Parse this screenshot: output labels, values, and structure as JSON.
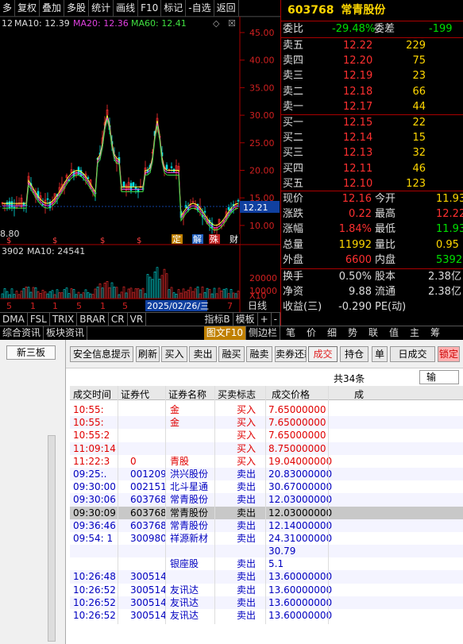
{
  "menu": [
    "多",
    "复权",
    "叠加",
    "多股",
    "统计",
    "画线",
    "F10",
    "标记",
    "-自选",
    "返回"
  ],
  "ma_line": {
    "prefix": "12",
    "ma10": "MA10: 12.39",
    "ma20": "MA20: 12.36",
    "ma60": "MA60: 12.41"
  },
  "price_axis": [
    "45.00",
    "40.00",
    "35.00",
    "30.00",
    "25.00",
    "20.00",
    "15.00",
    "10.00"
  ],
  "current_price_tag": "12.21",
  "low_label": "8.80",
  "vol_line": {
    "prefix": "3902",
    "ma10": "MA10: 24541"
  },
  "vol_axis": [
    "20000",
    "10000",
    "X10"
  ],
  "date_tag": "2025/02/26/三",
  "period_label": "日线",
  "event_marks": [
    "定",
    "解",
    "殊",
    "财"
  ],
  "indicator_tabs": [
    "DMA",
    "FSL",
    "TRIX",
    "BRAR",
    "CR",
    "VR"
  ],
  "tool_tabs": [
    "指标B",
    "模板",
    "+",
    "-"
  ],
  "sub_tabs": [
    "综合资讯",
    "板块资讯"
  ],
  "chart_link": "图文F10",
  "side_link": "侧边栏",
  "stock": {
    "code": "603768",
    "name": "常青股份"
  },
  "weibi": {
    "label": "委比",
    "value": "-29.48%",
    "label2": "委差",
    "value2": "-199"
  },
  "sells": [
    {
      "label": "卖五",
      "price": "12.22",
      "vol": "229"
    },
    {
      "label": "卖四",
      "price": "12.20",
      "vol": "75"
    },
    {
      "label": "卖三",
      "price": "12.19",
      "vol": "23"
    },
    {
      "label": "卖二",
      "price": "12.18",
      "vol": "66"
    },
    {
      "label": "卖一",
      "price": "12.17",
      "vol": "44"
    }
  ],
  "buys": [
    {
      "label": "买一",
      "price": "12.15",
      "vol": "22"
    },
    {
      "label": "买二",
      "price": "12.14",
      "vol": "15"
    },
    {
      "label": "买三",
      "price": "12.13",
      "vol": "32"
    },
    {
      "label": "买四",
      "price": "12.11",
      "vol": "46"
    },
    {
      "label": "买五",
      "price": "12.10",
      "vol": "123"
    }
  ],
  "stats": [
    {
      "l1": "现价",
      "v1": "12.16",
      "l2": "今开",
      "v2": "11.93"
    },
    {
      "l1": "涨跌",
      "v1": "0.22",
      "l2": "最高",
      "v2": "12.22"
    },
    {
      "l1": "涨幅",
      "v1": "1.84%",
      "l2": "最低",
      "v2": "11.93"
    },
    {
      "l1": "总量",
      "v1": "11992",
      "l2": "量比",
      "v2": "0.95"
    },
    {
      "l1": "外盘",
      "v1": "6600",
      "l2": "内盘",
      "v2": "5392"
    }
  ],
  "stats2": [
    {
      "l1": "换手",
      "v1": "0.50%",
      "l2": "股本",
      "v2": "2.38亿"
    },
    {
      "l1": "净资",
      "v1": "9.88",
      "l2": "流通",
      "v2": "2.38亿"
    },
    {
      "l1": "收益(三)",
      "v1": "-0.290",
      "l2": "PE(动)",
      "v2": ""
    }
  ],
  "right_tabs": [
    "笔",
    "价",
    "细",
    "势",
    "联",
    "值",
    "主",
    "筹"
  ],
  "left_panel": {
    "tab": "新三板"
  },
  "toolbar": {
    "buttons": [
      "安全信息提示",
      "刷新",
      "买入",
      "卖出",
      "融买",
      "融卖",
      "卖券还款",
      "成交",
      "持仓",
      "单",
      "日成交",
      "锁定"
    ]
  },
  "table_meta": {
    "count": "共34条",
    "search": "输"
  },
  "columns": [
    "成交时间",
    "证券代",
    "证券名称",
    "买卖标志",
    "成交价格",
    "成"
  ],
  "rows": [
    {
      "time": "10:55:",
      "code": "",
      "name": "金",
      "side": "买入",
      "price": "7.65000000",
      "color": "red"
    },
    {
      "time": "10:55:",
      "code": "",
      "name": "金",
      "side": "买入",
      "price": "7.65000000",
      "color": "red"
    },
    {
      "time": "10:55:2",
      "code": "",
      "name": "",
      "side": "买入",
      "price": "7.65000000",
      "color": "red"
    },
    {
      "time": "11:09:14",
      "code": "",
      "name": "",
      "side": "买入",
      "price": "8.75000000",
      "color": "red"
    },
    {
      "time": "11:22:3",
      "code": "0",
      "name": "青股",
      "side": "买入",
      "price": "19.04000000",
      "color": "red"
    },
    {
      "time": "09:25:.",
      "code": "001209",
      "name": "洪兴股份",
      "side": "卖出",
      "price": "20.83000000",
      "color": "blue"
    },
    {
      "time": "09:30:00",
      "code": "002151",
      "name": "北斗星通",
      "side": "卖出",
      "price": "30.67000000",
      "color": "blue"
    },
    {
      "time": "09:30:06",
      "code": "603768",
      "name": "常青股份",
      "side": "卖出",
      "price": "12.03000000",
      "color": "blue"
    },
    {
      "time": "09:30:09",
      "code": "603768",
      "name": "常青股份",
      "side": "卖出",
      "price": "12.03000000",
      "color": "sel"
    },
    {
      "time": "09:36:46",
      "code": "603768",
      "name": "常青股份",
      "side": "卖出",
      "price": "12.14000000",
      "color": "blue"
    },
    {
      "time": "09:54:  1",
      "code": "300980",
      "name": "祥源新材",
      "side": "卖出",
      "price": "24.31000000",
      "color": "blue"
    },
    {
      "time": "",
      "code": "",
      "name": "",
      "side": "",
      "price": "30.79",
      "color": "blue"
    },
    {
      "time": "",
      "code": "",
      "name": "银座股",
      "side": "卖出",
      "price": "5.1",
      "color": "blue"
    },
    {
      "time": "10:26:48",
      "code": "300514",
      "name": "",
      "side": "卖出",
      "price": "13.60000000",
      "color": "blue"
    },
    {
      "time": "10:26:52",
      "code": "300514",
      "name": "友讯达",
      "side": "卖出",
      "price": "13.60000000",
      "color": "blue"
    },
    {
      "time": "10:26:52",
      "code": "300514",
      "name": "友讯达",
      "side": "卖出",
      "price": "13.60000000",
      "color": "blue"
    },
    {
      "time": "10:26:52",
      "code": "300514",
      "name": "友讯达",
      "side": "卖出",
      "price": "13.60000000",
      "color": "blue"
    }
  ]
}
